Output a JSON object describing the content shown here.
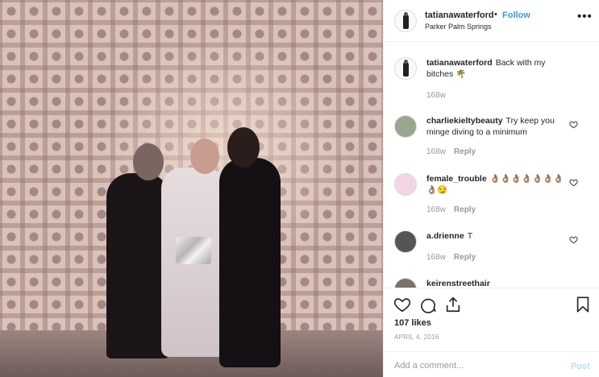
{
  "post": {
    "username": "tatianawaterford",
    "dot": "•",
    "follow_label": "Follow",
    "location": "Parker Palm Springs",
    "more_label": "•••"
  },
  "comments": [
    {
      "username": "tatianawaterford",
      "text": "Back with my bitches 🌴",
      "age": "168w",
      "reply": ""
    },
    {
      "username": "charliekieltybeauty",
      "text": "Try keep you minge diving to a minimum",
      "age": "168w",
      "reply": "Reply"
    },
    {
      "username": "female_trouble",
      "text": "👌🏽👌🏽👌🏽👌🏽👌🏽👌🏽👌🏽👌🏽😏",
      "age": "168w",
      "reply": "Reply"
    },
    {
      "username": "a.drienne",
      "text": "T",
      "age": "168w",
      "reply": "Reply"
    },
    {
      "username": "keirenstreethair",
      "text": "",
      "age": "",
      "reply": ""
    }
  ],
  "footer": {
    "likes": "107 likes",
    "date": "APRIL 4, 2016",
    "comment_placeholder": "Add a comment...",
    "post_label": "Post"
  },
  "colors": {
    "follow": "#3897f0",
    "post_disabled": "#b2dffc",
    "muted": "#999999"
  },
  "icons": [
    "heart-icon",
    "comment-icon",
    "share-icon",
    "bookmark-icon",
    "more-icon"
  ]
}
